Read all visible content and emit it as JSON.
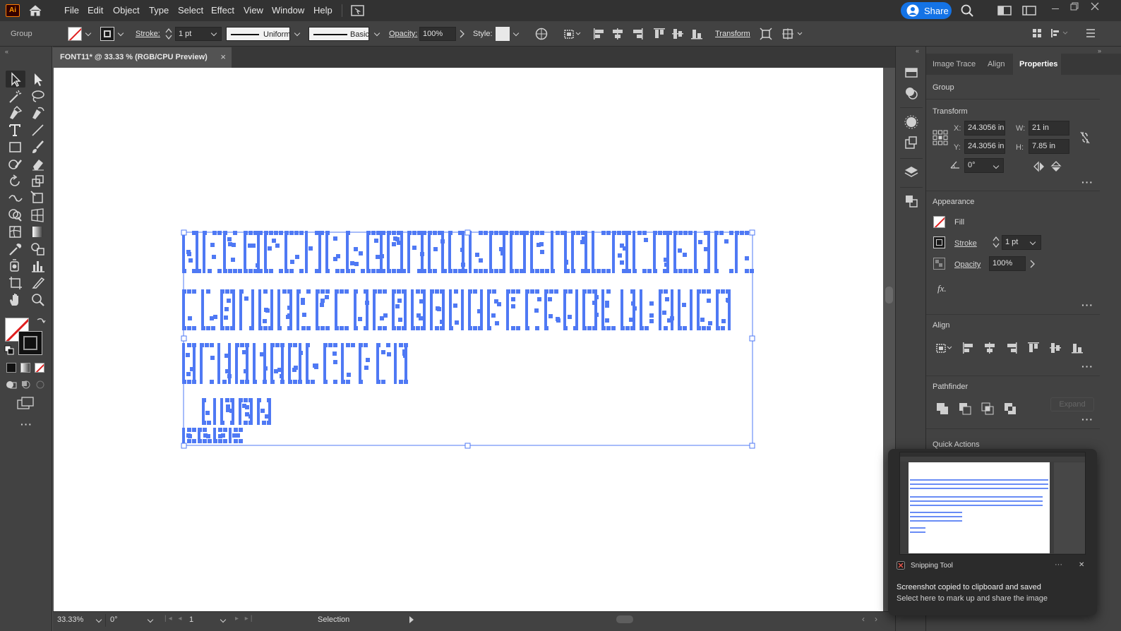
{
  "app": {
    "logo": "Ai"
  },
  "menus": [
    "File",
    "Edit",
    "Object",
    "Type",
    "Select",
    "Effect",
    "View",
    "Window",
    "Help"
  ],
  "header_right": {
    "share_label": "Share"
  },
  "control_bar": {
    "selection_type": "Group",
    "stroke_label": "Stroke:",
    "stroke_value": "1 pt",
    "profile": "Uniform",
    "brush": "Basic",
    "opacity_label": "Opacity:",
    "opacity_value": "100%",
    "style_label": "Style:",
    "transform_label": "Transform"
  },
  "document": {
    "tab_title": "FONT11* @ 33.33 % (RGB/CPU Preview)",
    "close": "×"
  },
  "status": {
    "zoom": "33.33%",
    "rotation": "0°",
    "artboard": "1",
    "tool": "Selection"
  },
  "panel": {
    "tabs": [
      "Image Trace",
      "Align",
      "Properties"
    ],
    "active_tab": "Properties",
    "object_type": "Group",
    "transform": {
      "title": "Transform",
      "x_label": "X:",
      "x": "24.3056 in",
      "y_label": "Y:",
      "y": "24.3056 in",
      "w_label": "W:",
      "w": "21 in",
      "h_label": "H:",
      "h": "7.85 in",
      "angle": "0°"
    },
    "appearance": {
      "title": "Appearance",
      "fill_label": "Fill",
      "stroke_label": "Stroke",
      "stroke_value": "1 pt",
      "opacity_label": "Opacity",
      "opacity_value": "100%",
      "fx_label": "fx."
    },
    "align_title": "Align",
    "pathfinder": {
      "title": "Pathfinder",
      "expand_label": "Expand"
    },
    "quick_actions_title": "Quick Actions"
  },
  "toast": {
    "app_name": "Snipping Tool",
    "menu": "···",
    "close": "✕",
    "line1": "Screenshot copied to clipboard and saved",
    "line2": "Select here to mark up and share the image"
  },
  "colors": {
    "selection": "#4f79f4",
    "share_button": "#1473e6",
    "panel_bg": "#424242",
    "canvas_bg": "#535353"
  }
}
